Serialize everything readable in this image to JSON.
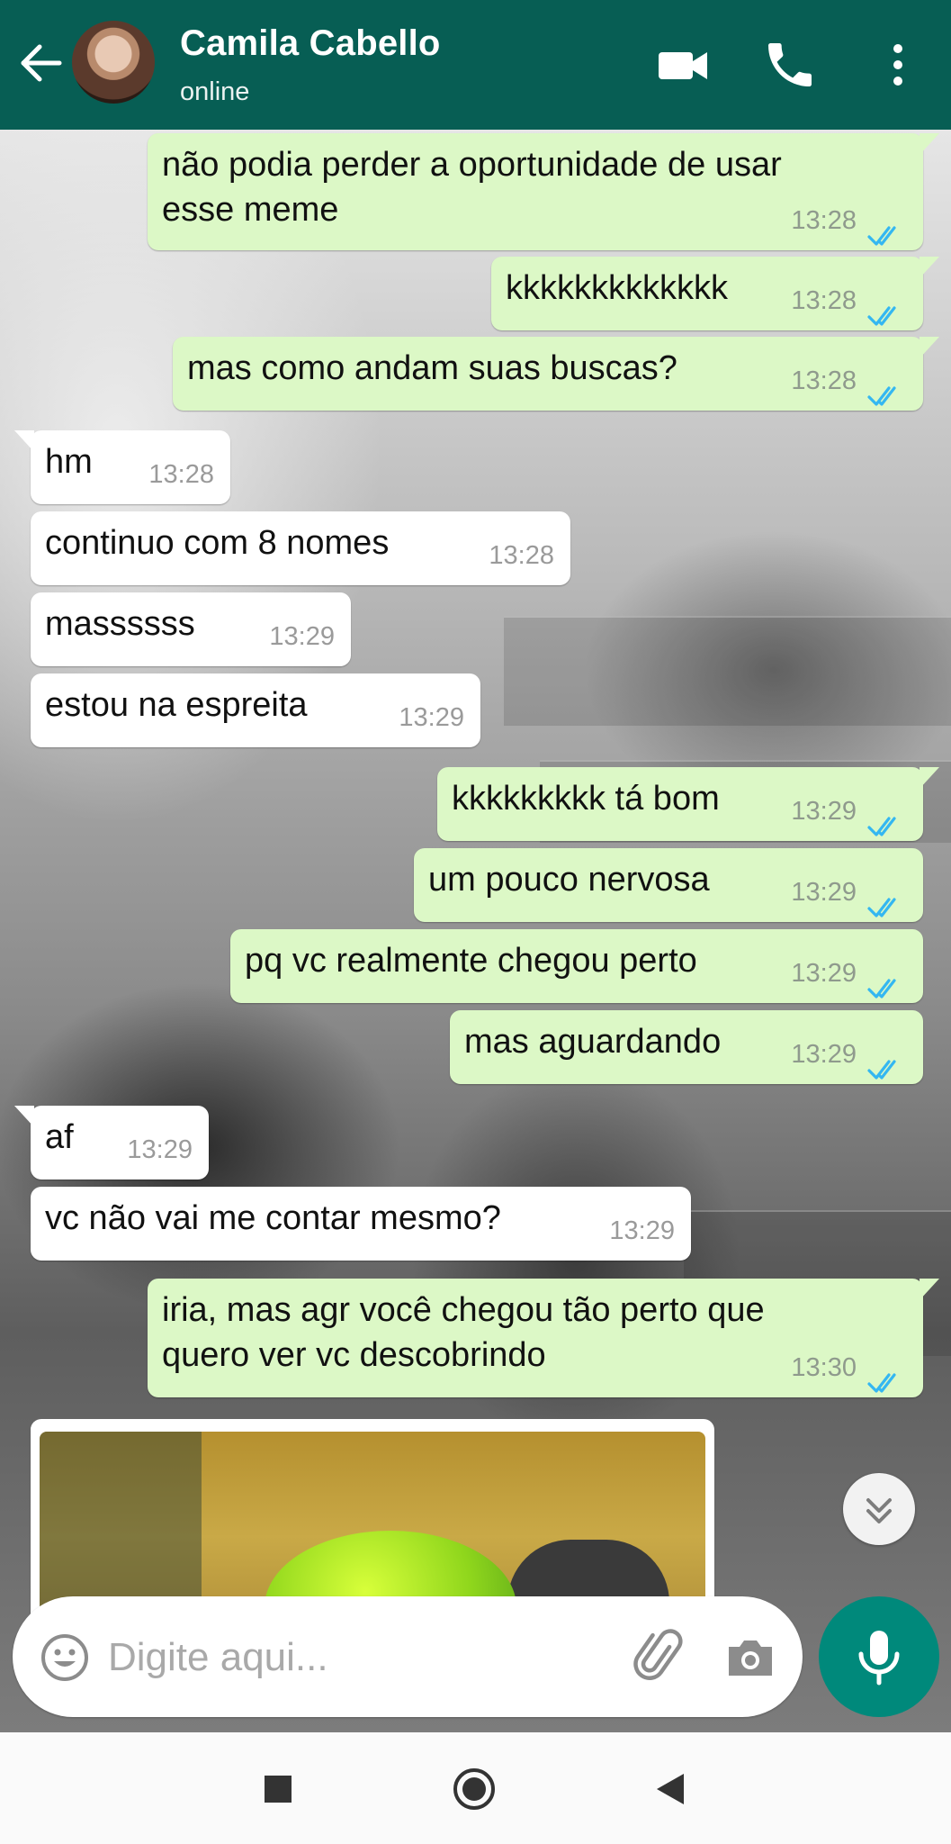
{
  "header": {
    "contact_name": "Camila Cabello",
    "status": "online"
  },
  "messages": [
    {
      "direction": "out",
      "text": "não podia perder a oportunidade de usar\nesse meme",
      "time": "13:28",
      "read": true
    },
    {
      "direction": "out",
      "text": "kkkkkkkkkkkkk",
      "time": "13:28",
      "read": true
    },
    {
      "direction": "out",
      "text": "mas como andam suas buscas?",
      "time": "13:28",
      "read": true
    },
    {
      "direction": "in",
      "text": "hm",
      "time": "13:28"
    },
    {
      "direction": "in",
      "text": "continuo com 8 nomes",
      "time": "13:28"
    },
    {
      "direction": "in",
      "text": "massssss",
      "time": "13:29"
    },
    {
      "direction": "in",
      "text": "estou na espreita",
      "time": "13:29"
    },
    {
      "direction": "out",
      "text": "kkkkkkkkk tá bom",
      "time": "13:29",
      "read": true
    },
    {
      "direction": "out",
      "text": "um pouco nervosa",
      "time": "13:29",
      "read": true
    },
    {
      "direction": "out",
      "text": "pq vc realmente chegou perto",
      "time": "13:29",
      "read": true
    },
    {
      "direction": "out",
      "text": "mas aguardando",
      "time": "13:29",
      "read": true
    },
    {
      "direction": "in",
      "text": "af",
      "time": "13:29"
    },
    {
      "direction": "in",
      "text": "vc não vai me contar mesmo?",
      "time": "13:29"
    },
    {
      "direction": "out",
      "text": "iria, mas agr você chegou tão perto que\nquero ver vc descobrindo",
      "time": "13:30",
      "read": true
    }
  ],
  "composer": {
    "placeholder": "Digite aqui..."
  },
  "colors": {
    "header": "#075e54",
    "bubble_out": "#dcf8c6",
    "bubble_in": "#ffffff",
    "read_ticks": "#34b7f1",
    "mic_button": "#00897b"
  },
  "icons": {
    "back": "back-arrow-icon",
    "video": "video-camera-icon",
    "call": "phone-icon",
    "menu": "more-vert-icon",
    "emoji": "emoji-icon",
    "attach": "paperclip-icon",
    "camera": "camera-icon",
    "mic": "mic-icon",
    "scroll": "double-chevron-down-icon"
  }
}
